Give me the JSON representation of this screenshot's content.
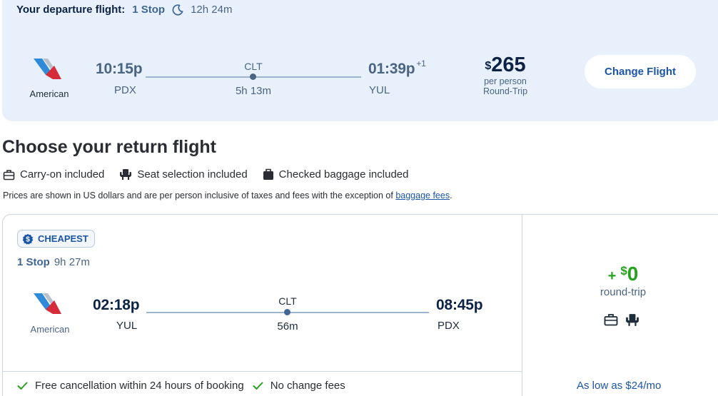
{
  "departure": {
    "label": "Your departure flight:",
    "stops": "1 Stop",
    "duration": "12h 24m",
    "airline": "American",
    "depart_time": "10:15p",
    "depart_code": "PDX",
    "stop_code": "CLT",
    "layover": "5h 13m",
    "arrive_time": "01:39p",
    "arrive_plus": "+1",
    "arrive_code": "YUL",
    "price_currency": "$",
    "price_value": "265",
    "price_per": "per person",
    "price_trip": "Round-Trip",
    "change_label": "Change Flight"
  },
  "heading": "Choose your return flight",
  "amenities": [
    {
      "icon": "carry-on-icon",
      "label": "Carry-on included"
    },
    {
      "icon": "seat-icon",
      "label": "Seat selection included"
    },
    {
      "icon": "checked-bag-icon",
      "label": "Checked baggage included"
    }
  ],
  "notice": {
    "text": "Prices are shown in US dollars and are per person inclusive of taxes and fees with the exception of ",
    "link": "baggage fees",
    "end": "."
  },
  "option": {
    "badge": "CHEAPEST",
    "stops": "1 Stop",
    "duration": "9h 27m",
    "airline": "American",
    "depart_time": "02:18p",
    "depart_code": "YUL",
    "stop_code": "CLT",
    "layover": "56m",
    "arrive_time": "08:45p",
    "arrive_code": "PDX",
    "addon_plus": "+",
    "addon_currency": "$",
    "addon_value": "0",
    "addon_label": "round-trip",
    "policies": [
      "Free cancellation within 24 hours of booking",
      "No change fees"
    ],
    "financing": "As low as $24/mo"
  },
  "colors": {
    "banner_bg": "#e8f0fb",
    "accent_blue": "#1a55a8",
    "price_green": "#26a21e",
    "stop_blue": "#3f6592"
  }
}
